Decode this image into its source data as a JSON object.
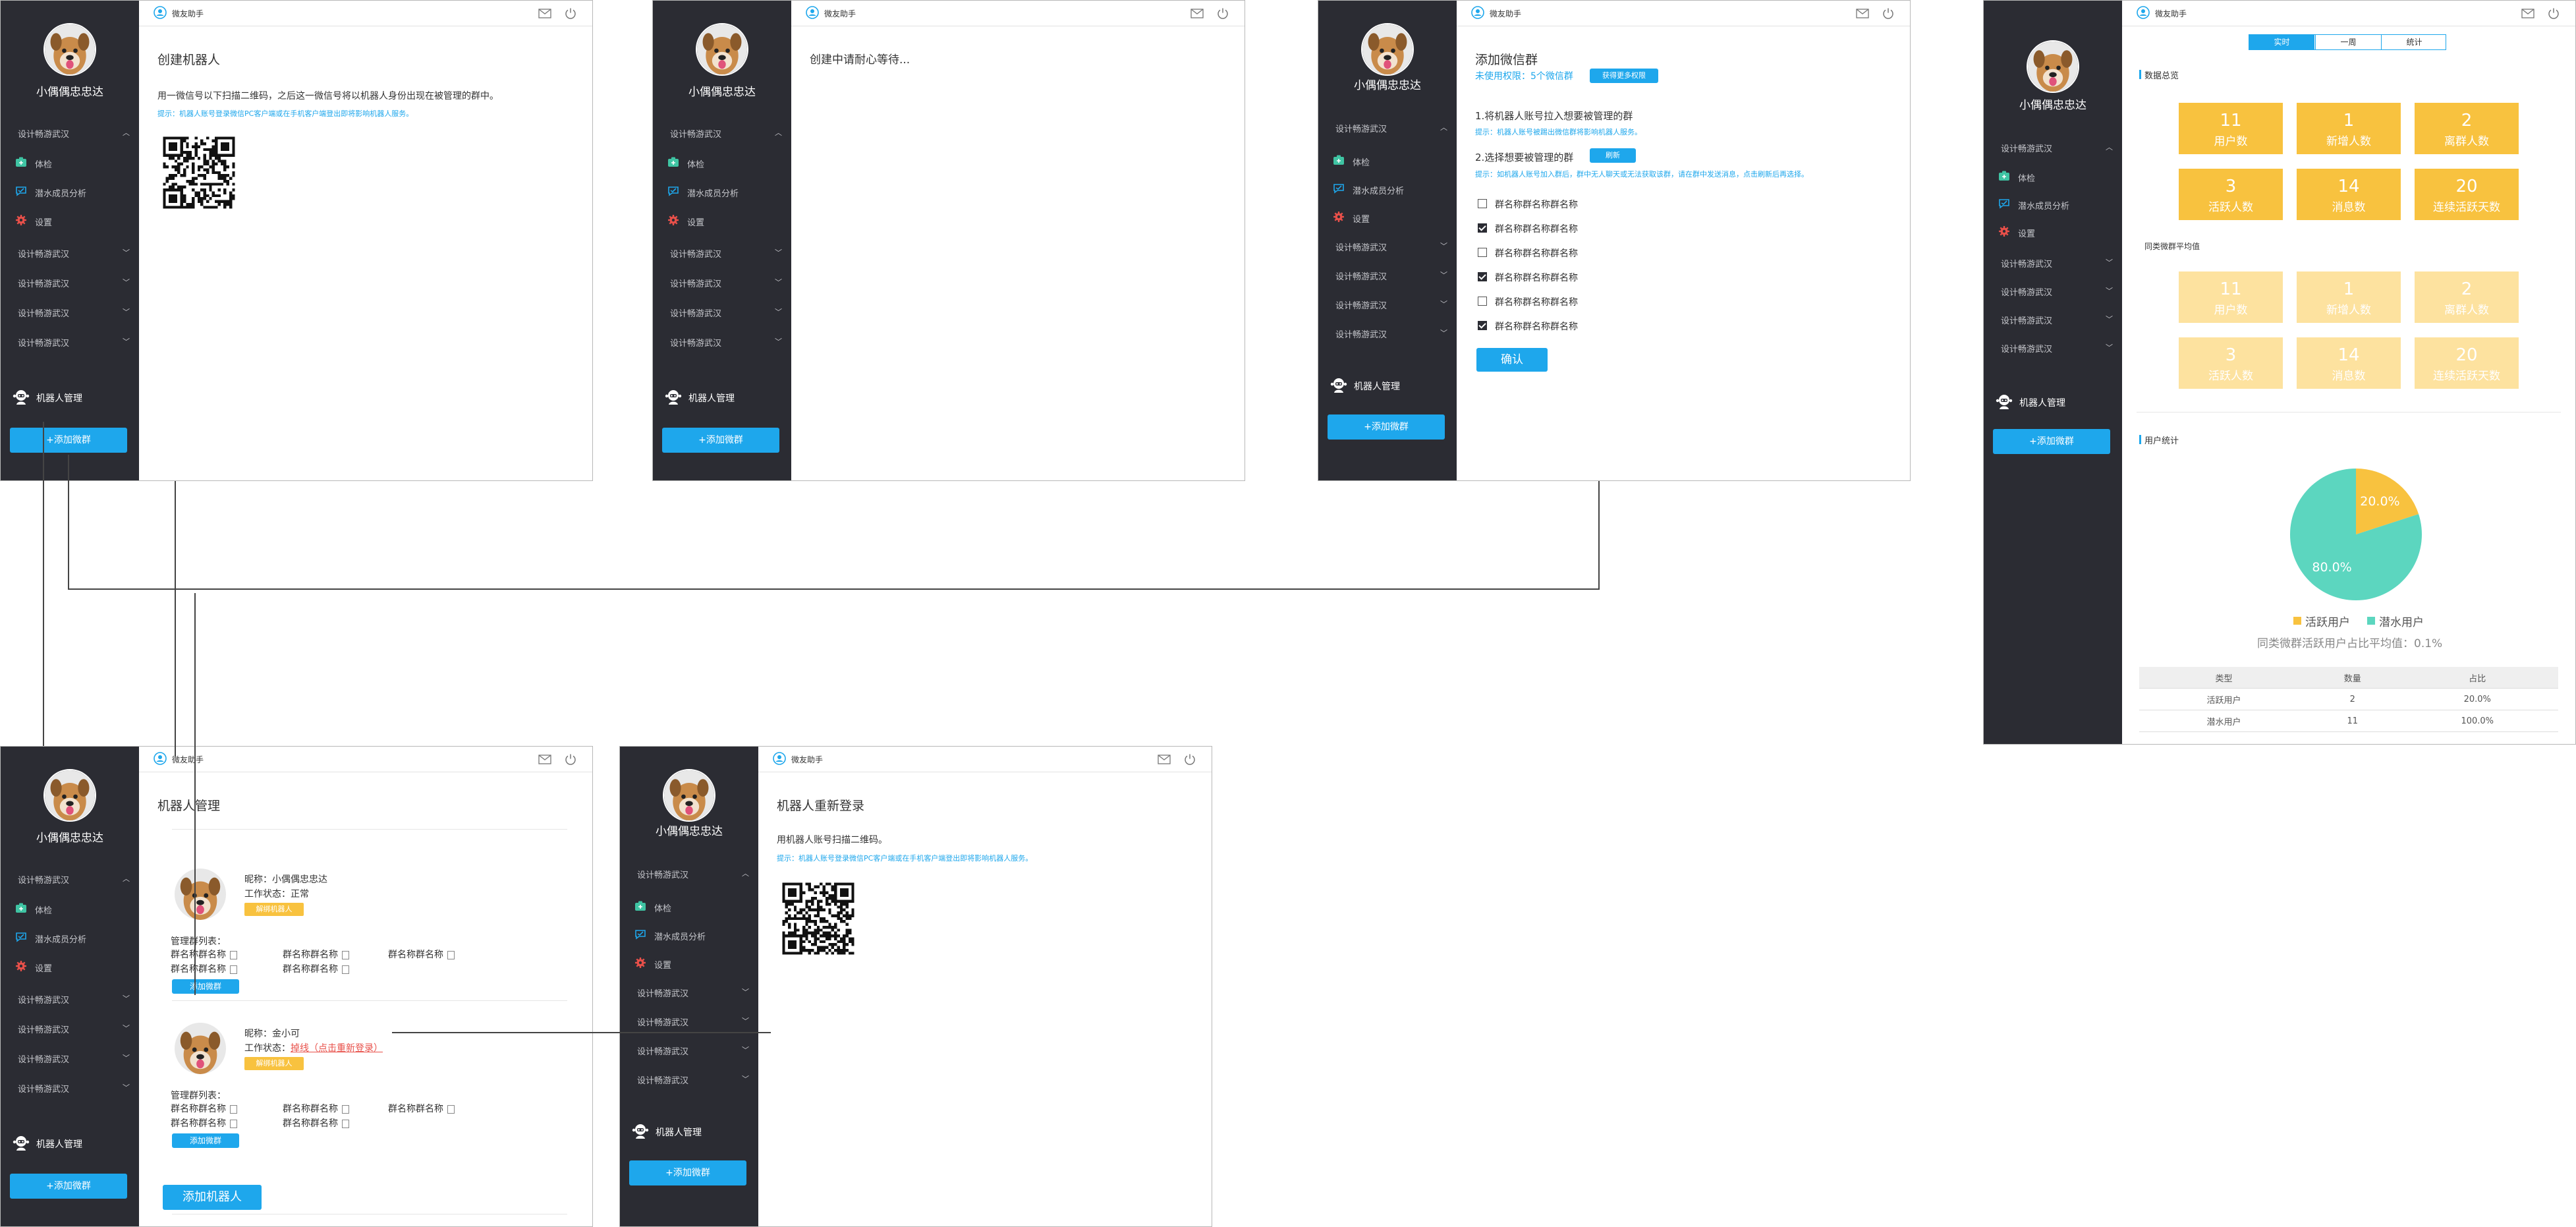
{
  "common": {
    "user_name": "小偶偶忠忠达",
    "app_name": "微友助手",
    "nav_group": "设计畅游武汉",
    "nav_items": [
      "体检",
      "潜水成员分析",
      "设置"
    ],
    "robot_management": "机器人管理",
    "add_group_button": "+添加微群",
    "colors": {
      "sidebar": "#2b2c33",
      "accent": "#1ea7ec",
      "yellow": "#f8c23f",
      "light_yellow": "#fde29f",
      "pie_green": "#5cd6bf"
    }
  },
  "screen1": {
    "title": "创建机器人",
    "instruction": "用一微信号以下扫描二维码，之后这一微信号将以机器人身份出现在被管理的群中。",
    "hint": "提示：机器人账号登录微信PC客户端或在手机客户端登出即将影响机器人服务。"
  },
  "screen2": {
    "message": "创建中请耐心等待..."
  },
  "screen3": {
    "title": "添加微信群",
    "permission": "未使用权限：5个微信群",
    "more_button": "获得更多权限",
    "step1": "1.将机器人账号拉入想要被管理的群",
    "step1_hint": "提示：机器人账号被踢出微信群将影响机器人服务。",
    "step2": "2.选择想要被管理的群",
    "refresh_button": "刷新",
    "step2_hint": "提示：如机器人账号加入群后，群中无人聊天或无法获取该群，请在群中发送消息，点击刷新后再选择。",
    "groups": [
      {
        "name": "群名称群名称群名称",
        "checked": false
      },
      {
        "name": "群名称群名称群名称",
        "checked": true
      },
      {
        "name": "群名称群名称群名称",
        "checked": false
      },
      {
        "name": "群名称群名称群名称",
        "checked": true
      },
      {
        "name": "群名称群名称群名称",
        "checked": false
      },
      {
        "name": "群名称群名称群名称",
        "checked": true
      }
    ],
    "confirm": "确认"
  },
  "screen4": {
    "tabs": [
      "实时",
      "一周",
      "统计"
    ],
    "section_summary": "数据总览",
    "stats": [
      {
        "num": "11",
        "label": "用户数"
      },
      {
        "num": "1",
        "label": "新增人数"
      },
      {
        "num": "2",
        "label": "离群人数"
      },
      {
        "num": "3",
        "label": "活跃人数"
      },
      {
        "num": "14",
        "label": "消息数"
      },
      {
        "num": "20",
        "label": "连续活跃天数"
      }
    ],
    "section_avg": "同类微群平均值",
    "avg_stats": [
      {
        "num": "11",
        "label": "用户数"
      },
      {
        "num": "1",
        "label": "新增人数"
      },
      {
        "num": "2",
        "label": "离群人数"
      },
      {
        "num": "3",
        "label": "活跃人数"
      },
      {
        "num": "14",
        "label": "消息数"
      },
      {
        "num": "20",
        "label": "连续活跃天数"
      }
    ],
    "section_users": "用户统计",
    "pie": {
      "slices": [
        {
          "name": "活跃用户",
          "value": 20.0,
          "label": "20.0%",
          "color": "#f8c23f"
        },
        {
          "name": "潜水用户",
          "value": 80.0,
          "label": "80.0%",
          "color": "#5cd6bf"
        }
      ]
    },
    "avg_note": "同类微群活跃用户占比平均值：0.1%",
    "table": {
      "headers": [
        "类型",
        "数量",
        "占比"
      ],
      "rows": [
        [
          "活跃用户",
          "2",
          "20.0%"
        ],
        [
          "潜水用户",
          "11",
          "100.0%"
        ]
      ]
    }
  },
  "screen5": {
    "title": "机器人管理",
    "robots": [
      {
        "nickname": "昵称：小偶偶忠忠达",
        "status_label": "工作状态：",
        "status_value": "正常",
        "unbind": "解绑机器人",
        "list_title": "管理群列表：",
        "groups": [
          "群名称群名称",
          "群名称群名称",
          "群名称群名称",
          "群名称群名称",
          "群名称群名称"
        ],
        "add": "添加微群"
      },
      {
        "nickname": "昵称：金小可",
        "status_label": "工作状态：",
        "status_value": "掉线（点击重新登录）",
        "unbind": "解绑机器人",
        "list_title": "管理群列表：",
        "groups": [
          "群名称群名称",
          "群名称群名称",
          "群名称群名称",
          "群名称群名称",
          "群名称群名称"
        ],
        "add": "添加微群"
      }
    ],
    "add_robot": "添加机器人"
  },
  "screen6": {
    "title": "机器人重新登录",
    "instruction": "用机器人账号扫描二维码。",
    "hint": "提示：机器人账号登录微信PC客户端或在手机客户端登出即将影响机器人服务。"
  }
}
